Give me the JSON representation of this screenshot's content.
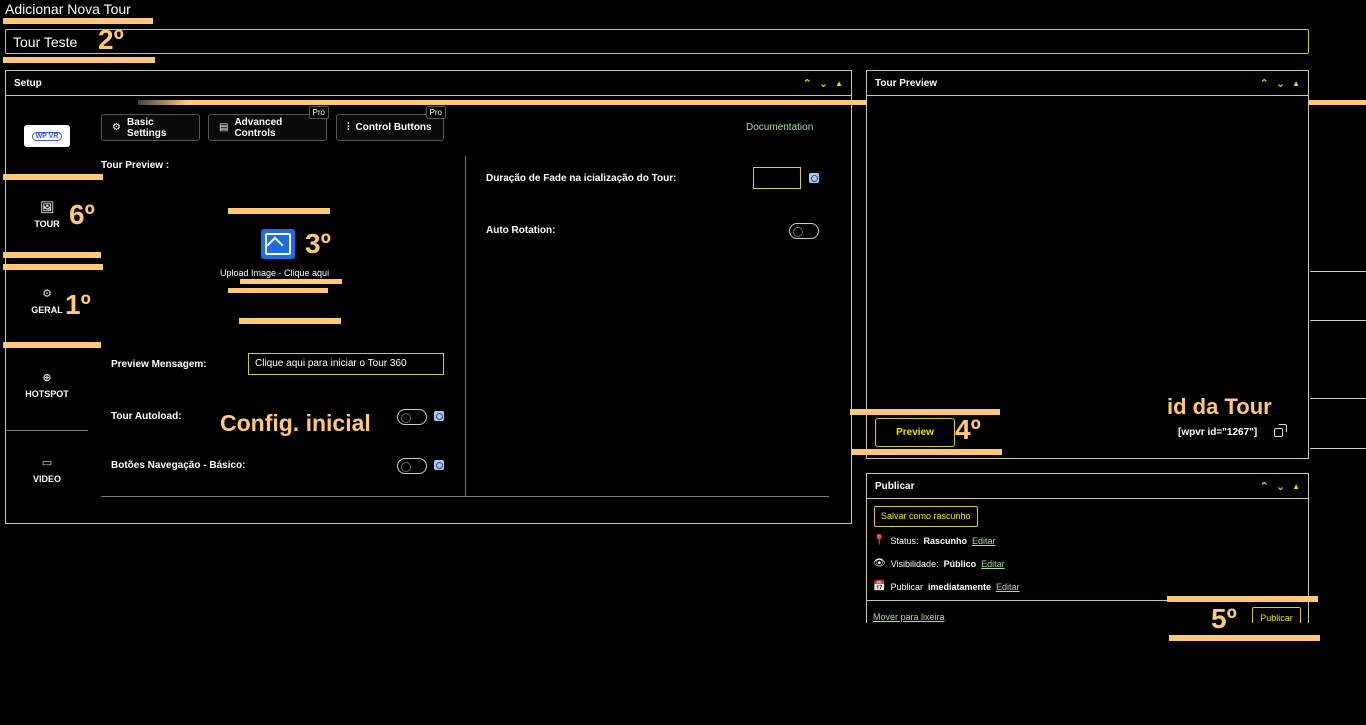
{
  "page": {
    "heading": "Adicionar Nova Tour",
    "tour_title_value": "Tour Teste"
  },
  "setup": {
    "title": "Setup",
    "logo_text": "WP VR",
    "tabs": [
      {
        "label": "Basic Settings",
        "icon": "gear-icon"
      },
      {
        "label": "Advanced Controls",
        "icon": "sliders-icon",
        "badge": "Pro"
      },
      {
        "label": "Control Buttons",
        "icon": "control-buttons-icon",
        "badge": "Pro"
      }
    ],
    "documentation": "Documentation",
    "sidebar": [
      {
        "label": "TOUR",
        "icon": "image-icon"
      },
      {
        "label": "GERAL",
        "icon": "gear-icon"
      },
      {
        "label": "HOTSPOT",
        "icon": "crosshair-icon"
      },
      {
        "label": "VIDEO",
        "icon": "video-icon"
      }
    ],
    "tour_preview_label": "Tour Preview :",
    "upload_label": "Upload Image - Clique aqui",
    "preview_message_label": "Preview Mensagem:",
    "preview_message_value": "Clique aqui para iniciar o Tour 360",
    "tour_autoload_label": "Tour Autoload:",
    "nav_buttons_label": "Botões Navegação - Básico:",
    "fade_label": "Duração de Fade na icialização do Tour:",
    "auto_rotation_label": "Auto Rotation:"
  },
  "tour_preview_panel": {
    "title": "Tour Preview",
    "preview_button": "Preview",
    "shortcode": "[wpvr id=\"1267\"]"
  },
  "publish": {
    "title": "Publicar",
    "save_draft": "Salvar como rascunho",
    "status_label": "Status:",
    "status_value": "Rascunho",
    "visibility_label": "Visibilidade:",
    "visibility_value": "Público",
    "publish_label": "Publicar",
    "publish_value": "imediatamente",
    "edit": "Editar",
    "trash": "Mover para lixeira",
    "publish_button": "Publicar"
  },
  "annotations": {
    "n1": "1º",
    "n2": "2º",
    "n3": "3º",
    "n4": "4º",
    "n5": "5º",
    "n6": "6º",
    "config": "Config. inicial",
    "id_tour": "id da Tour"
  },
  "colors": {
    "accent": "#e6e600",
    "annotation": "#ffc878",
    "link": "#9fe09f",
    "border": "#c8c8a0"
  }
}
